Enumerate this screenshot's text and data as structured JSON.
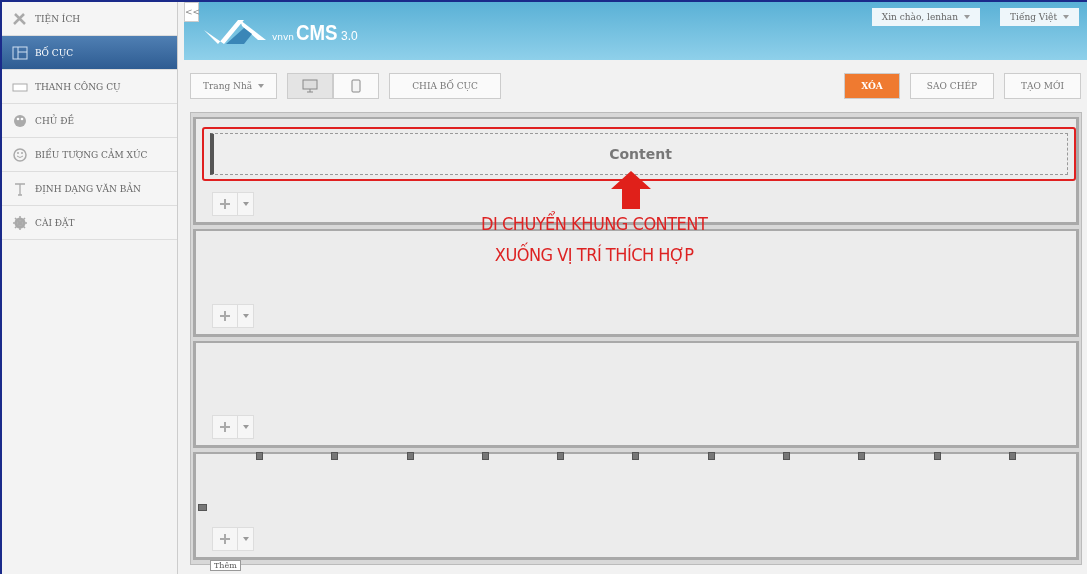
{
  "sidebar": {
    "items": [
      {
        "label": "TIỆN ÍCH",
        "selected": false
      },
      {
        "label": "BỐ CỤC",
        "selected": true
      },
      {
        "label": "THANH CÔNG CỤ",
        "selected": false
      },
      {
        "label": "CHỦ ĐỀ",
        "selected": false
      },
      {
        "label": "BIỂU TƯỢNG CẢM XÚC",
        "selected": false
      },
      {
        "label": "ĐỊNH DẠNG VĂN BẢN",
        "selected": false
      },
      {
        "label": "CÀI ĐẶT",
        "selected": false
      }
    ]
  },
  "collapse_button": "<<",
  "header": {
    "logo": {
      "brand": "vnvn",
      "product": "CMS",
      "version": "3.0"
    },
    "user_menu": "Xin chào, lenhan",
    "language_menu": "Tiếng Việt"
  },
  "toolbar": {
    "page_select": "Trang Nhã",
    "devices": [
      {
        "kind": "desktop",
        "selected": true
      },
      {
        "kind": "mobile",
        "selected": false
      }
    ],
    "split_button": "CHIA BỐ CỤC",
    "actions": [
      {
        "label": "XÓA",
        "kind": "danger"
      },
      {
        "label": "SAO CHÉP",
        "kind": "default"
      },
      {
        "label": "TẠO MỚI",
        "kind": "default"
      }
    ]
  },
  "rows": [
    {
      "content": "Content",
      "highlighted": true,
      "resize_handles": false
    },
    {
      "highlighted": false,
      "resize_handles": false
    },
    {
      "highlighted": false,
      "resize_handles": false
    },
    {
      "highlighted": false,
      "resize_handles": true,
      "tooltip": "Thêm"
    }
  ],
  "annotation": {
    "lines": [
      "DI CHUYỂN KHUNG CONTENT",
      "XUỐNG VỊ TRÍ THÍCH HỢP"
    ]
  }
}
